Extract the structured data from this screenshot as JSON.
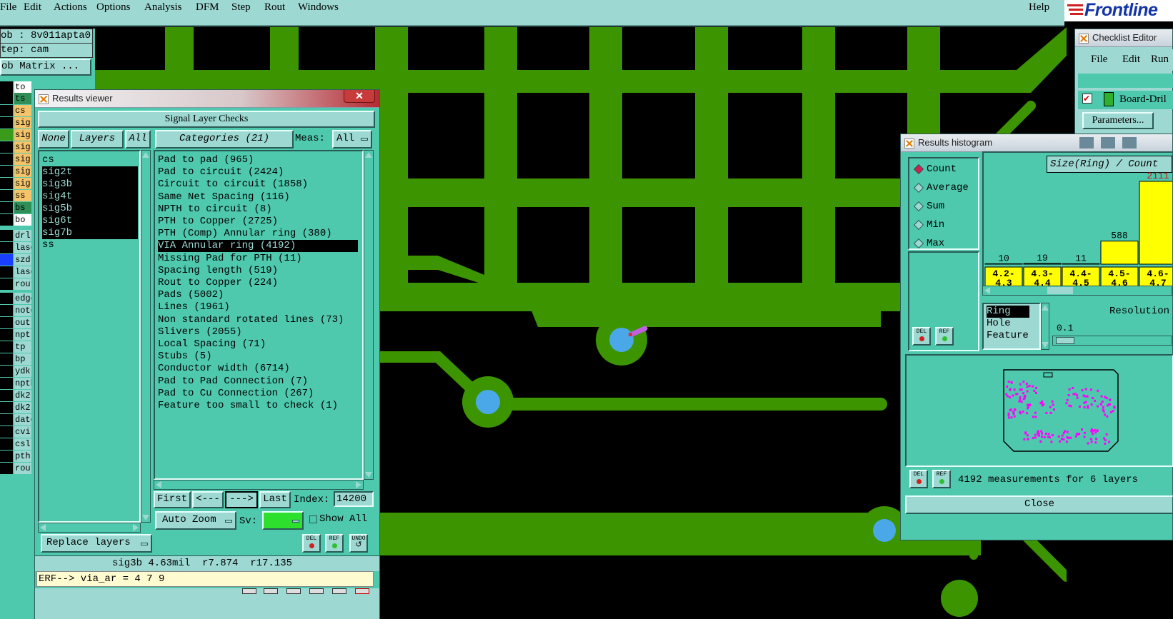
{
  "menubar": {
    "items": [
      "File",
      "Edit",
      "Actions",
      "Options",
      "Analysis",
      "DFM",
      "Step",
      "Rout",
      "Windows"
    ],
    "help": "Help",
    "logo": "Frontline"
  },
  "job_panel": {
    "job_label": "ob : 8v011apta0",
    "step_label": "tep: cam",
    "matrix_button": "ob Matrix ...",
    "layers": [
      {
        "name": "to",
        "bg": "#ffffff",
        "ind": "#000000"
      },
      {
        "name": "ts",
        "bg": "#2f8f57",
        "ind": "#000000"
      },
      {
        "name": "cs",
        "bg": "#f5c36a",
        "ind": "#000000"
      },
      {
        "name": "sig",
        "bg": "#f5c36a",
        "ind": "#000000"
      },
      {
        "name": "sig",
        "bg": "#f5c36a",
        "ind": "#3a9a1a"
      },
      {
        "name": "sig",
        "bg": "#f5c36a",
        "ind": "#000000"
      },
      {
        "name": "sig",
        "bg": "#f5c36a",
        "ind": "#000000"
      },
      {
        "name": "sig",
        "bg": "#f5c36a",
        "ind": "#000000"
      },
      {
        "name": "sig",
        "bg": "#f5c36a",
        "ind": "#000000"
      },
      {
        "name": "ss",
        "bg": "#f5c36a",
        "ind": "#000000"
      },
      {
        "name": "bs",
        "bg": "#2f8f57",
        "ind": "#000000"
      },
      {
        "name": "bo",
        "bg": "#ffffff",
        "ind": "#000000"
      },
      {
        "name": "drl",
        "bg": "#9dd9d2",
        "ind": "#000000"
      },
      {
        "name": "lase",
        "bg": "#9dd9d2",
        "ind": "#000000"
      },
      {
        "name": "szdr",
        "bg": "#9dd9d2",
        "ind": "#1a3fff"
      },
      {
        "name": "lase",
        "bg": "#9dd9d2",
        "ind": "#000000"
      },
      {
        "name": "rout",
        "bg": "#9dd9d2",
        "ind": "#000000"
      },
      {
        "name": "edge",
        "bg": "#9dd9d2",
        "ind": "#000000"
      },
      {
        "name": "note",
        "bg": "#9dd9d2",
        "ind": "#000000"
      },
      {
        "name": "outl",
        "bg": "#9dd9d2",
        "ind": "#000000"
      },
      {
        "name": "npt",
        "bg": "#9dd9d2",
        "ind": "#000000"
      },
      {
        "name": "tp",
        "bg": "#9dd9d2",
        "ind": "#000000"
      },
      {
        "name": "bp",
        "bg": "#9dd9d2",
        "ind": "#000000"
      },
      {
        "name": "ydk",
        "bg": "#9dd9d2",
        "ind": "#000000"
      },
      {
        "name": "npth",
        "bg": "#9dd9d2",
        "ind": "#000000"
      },
      {
        "name": "dk2",
        "bg": "#9dd9d2",
        "ind": "#000000"
      },
      {
        "name": "dk2",
        "bg": "#9dd9d2",
        "ind": "#000000"
      },
      {
        "name": "date",
        "bg": "#9dd9d2",
        "ind": "#000000"
      },
      {
        "name": "cvi",
        "bg": "#9dd9d2",
        "ind": "#000000"
      },
      {
        "name": "csl",
        "bg": "#9dd9d2",
        "ind": "#000000"
      },
      {
        "name": "pth",
        "bg": "#9dd9d2",
        "ind": "#000000"
      },
      {
        "name": "rout",
        "bg": "#9dd9d2",
        "ind": "#000000"
      }
    ]
  },
  "results_viewer": {
    "title": "Results viewer",
    "header": "Signal Layer Checks",
    "none_btn": "None",
    "layers_btn": "Layers",
    "all_btn": "All",
    "categories_btn": "Categories (21)",
    "meas_label": "Meas:",
    "meas_value": "All",
    "layers": [
      "cs",
      "sig2t",
      "sig3b",
      "sig4t",
      "sig5b",
      "sig6t",
      "sig7b",
      "ss"
    ],
    "selected_layers": [
      1,
      2,
      3,
      4,
      5,
      6
    ],
    "categories": [
      "Pad to pad (965)",
      "Pad to circuit (2424)",
      "Circuit to circuit (1858)",
      "Same Net Spacing (116)",
      "NPTH to circuit (8)",
      "PTH to Copper (2725)",
      "PTH (Comp) Annular ring (380)",
      "VIA Annular ring (4192)",
      "Missing Pad for PTH (11)",
      "Spacing length (519)",
      "Rout to Copper (224)",
      "Pads (5002)",
      "Lines (1961)",
      "Non standard rotated lines (73)",
      "Slivers (2055)",
      "Local Spacing (71)",
      "Stubs (5)",
      "Conductor width (6714)",
      "Pad to Pad Connection (7)",
      "Pad to Cu Connection (267)",
      "Feature too small to check (1)"
    ],
    "selected_category": 7,
    "first_btn": "First",
    "prev_btn": "<---",
    "next_btn": "--->",
    "last_btn": "Last",
    "index_label": "Index:",
    "index_value": "14200",
    "auto_zoom": "Auto Zoom",
    "sv_label": "Sv:",
    "show_all": "Show All",
    "replace_layers": "Replace layers",
    "del_label": "DEL",
    "ref_label": "REF",
    "undo_label": "UNDO",
    "status": "sig3b 4.63mil  r7.874  r17.135",
    "erf_line": "ERF--> via_ar = 4 7 9"
  },
  "checklist_editor": {
    "title": "Checklist Editor",
    "menu": [
      "File",
      "Edit",
      "Run"
    ],
    "item": "Board-Dril",
    "parameters_btn": "Parameters..."
  },
  "histogram": {
    "title": "Results histogram",
    "options": [
      "Count",
      "Average",
      "Sum",
      "Min",
      "Max"
    ],
    "selected_option": 0,
    "chart_label": "Size(Ring) / Count",
    "counts": [
      "10",
      "19",
      "11",
      "588",
      "2111"
    ],
    "bins": [
      "4.2-\n4.3",
      "4.3-\n4.4",
      "4.4-\n4.5",
      "4.5-\n4.6",
      "4.6-\n4.7"
    ],
    "by_list": [
      "Ring",
      "Hole",
      "Feature"
    ],
    "resolution_label": "Resolution",
    "resolution_value": "0.1",
    "del_label": "DEL",
    "ref_label": "REF",
    "summary": "4192 measurements for 6 layers",
    "close_btn": "Close"
  },
  "colors": {
    "copper": "#3c9400",
    "via": "#4aa8e8",
    "panel": "#4fc9ad",
    "button": "#9dd9d2",
    "bar": "#ffff00",
    "scatter": "#ff00ff"
  }
}
